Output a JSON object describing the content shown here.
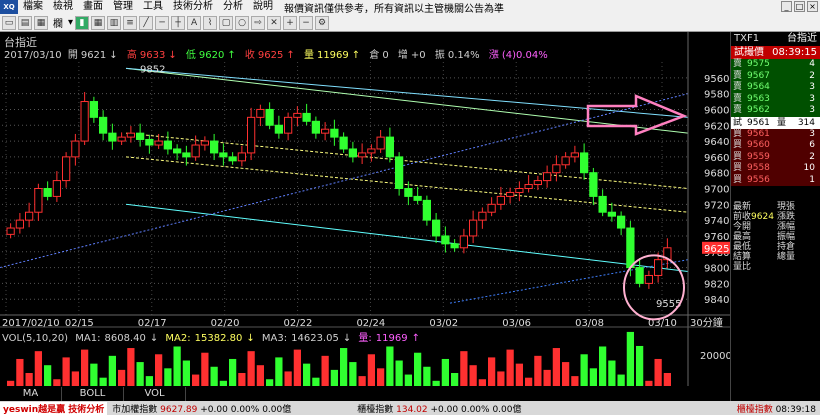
{
  "menubar": {
    "logo": "XQ",
    "items": [
      "檔案",
      "檢視",
      "畫面",
      "管理",
      "工具",
      "技術分析",
      "分析",
      "說明"
    ],
    "notice": "報價資訊僅供參考，所有資訊以主管機關公告為準"
  },
  "toolbar": {
    "label_a": "欄",
    "label_b": "▾"
  },
  "chart": {
    "name": "台指近",
    "date": "2017/03/10",
    "open_label": "開",
    "open": "9621",
    "high_label": "高",
    "high": "9633",
    "low_label": "低",
    "low": "9620",
    "close_label": "收",
    "close": "9625",
    "vol_label": "量",
    "vol": "11969",
    "oi_label": "倉",
    "oi": "0",
    "oi_chg_label": "增",
    "oi_chg": "+0",
    "amp_label": "振",
    "amp": "0.14%",
    "chg_label": "漲",
    "chg": "(4)0.04%",
    "peak_label": "9852",
    "trough_label": "9555",
    "current_price_tag": "9625",
    "period_label": "30分鐘",
    "y_ticks": [
      "9840",
      "9820",
      "9800",
      "9780",
      "9760",
      "9740",
      "9720",
      "9700",
      "9680",
      "9660",
      "9640",
      "9620",
      "9600",
      "9580",
      "9560"
    ],
    "x_ticks": [
      "2017/02/10",
      "02/15",
      "02/17",
      "02/20",
      "02/22",
      "02/24",
      "03/02",
      "03/06",
      "03/08",
      "03/10"
    ],
    "vol_tick": "20000",
    "vol_info": {
      "label": "VOL(5,10,20)",
      "ma1_label": "MA1:",
      "ma1": "8608.40",
      "ma2_label": "MA2:",
      "ma2": "15382.80",
      "ma3_label": "MA3:",
      "ma3": "14623.05",
      "vol_label": "量:",
      "vol": "11969"
    }
  },
  "chart_data": {
    "type": "candlestick",
    "title": "台指近",
    "period": "30分鐘",
    "ylim": [
      9540,
      9860
    ],
    "y_ticks": [
      9560,
      9580,
      9600,
      9620,
      9640,
      9660,
      9680,
      9700,
      9720,
      9740,
      9760,
      9780,
      9800,
      9820,
      9840
    ],
    "x_ticks": [
      "2017/02/10",
      "02/15",
      "02/17",
      "02/20",
      "02/22",
      "02/24",
      "03/02",
      "03/06",
      "03/08",
      "03/10"
    ],
    "close_path": [
      9650,
      9660,
      9670,
      9700,
      9690,
      9710,
      9740,
      9760,
      9810,
      9790,
      9770,
      9760,
      9765,
      9770,
      9762,
      9755,
      9760,
      9750,
      9745,
      9740,
      9755,
      9760,
      9745,
      9740,
      9735,
      9745,
      9790,
      9800,
      9780,
      9770,
      9790,
      9795,
      9785,
      9770,
      9775,
      9765,
      9750,
      9740,
      9745,
      9750,
      9765,
      9740,
      9700,
      9690,
      9685,
      9660,
      9640,
      9630,
      9625,
      9640,
      9660,
      9670,
      9680,
      9690,
      9695,
      9700,
      9705,
      9710,
      9720,
      9730,
      9740,
      9745,
      9720,
      9690,
      9670,
      9665,
      9650,
      9600,
      9580,
      9590,
      9610,
      9625
    ],
    "annotations": {
      "high": 9852,
      "low": 9555,
      "last": 9625
    },
    "volume_ylim": [
      0,
      30000
    ]
  },
  "right_panel": {
    "symbol": "TXF1",
    "name": "台指近",
    "title": "試撮價",
    "time": "08:39:15",
    "asks": [
      {
        "side": "賣",
        "price": "9575",
        "qty": "4"
      },
      {
        "side": "賣",
        "price": "9567",
        "qty": "2"
      },
      {
        "side": "賣",
        "price": "9564",
        "qty": "3"
      },
      {
        "side": "賣",
        "price": "9563",
        "qty": "3"
      },
      {
        "side": "賣",
        "price": "9562",
        "qty": "3"
      }
    ],
    "mid": {
      "side": "試",
      "price": "9561",
      "label": "量",
      "qty": "314"
    },
    "bids": [
      {
        "side": "買",
        "price": "9561",
        "qty": "3"
      },
      {
        "side": "買",
        "price": "9560",
        "qty": "6"
      },
      {
        "side": "買",
        "price": "9559",
        "qty": "2"
      },
      {
        "side": "買",
        "price": "9558",
        "qty": "10"
      },
      {
        "side": "買",
        "price": "9556",
        "qty": "1"
      }
    ],
    "stats": [
      {
        "a": "最新",
        "av": "",
        "b": "現張"
      },
      {
        "a": "前收",
        "av": "9624",
        "b": "漲跌"
      },
      {
        "a": "今開",
        "av": "",
        "b": "漲幅"
      },
      {
        "a": "最高",
        "av": "",
        "b": "振幅"
      },
      {
        "a": "最低",
        "av": "",
        "b": "持倉"
      },
      {
        "a": "結算",
        "av": "",
        "b": "總量"
      },
      {
        "a": "量比",
        "av": "",
        "b": ""
      }
    ]
  },
  "bottom_tabs": [
    "MA",
    "BOLL",
    "VOL"
  ],
  "statusbar": {
    "brand": "yeswin越是贏 技術分析",
    "idx1_label": "市加權指數",
    "idx1_value": "9627.89",
    "idx1_chg": "+0.00",
    "idx1_pct": "0.00%",
    "idx1_amt": "0.00億",
    "idx2_label": "櫃檯指數",
    "idx2_value": "134.02",
    "idx2_chg": "+0.00",
    "idx2_pct": "0.00%",
    "idx2_amt": "0.00億",
    "time_label": "櫃檯指數",
    "time": "08:39:18"
  },
  "colors": {
    "up": "#ff3030",
    "down": "#30ff30",
    "ask_bg": "#005000",
    "bid_bg": "#500000",
    "arrow": "#ff80c0",
    "circle": "#ffb0d0"
  }
}
